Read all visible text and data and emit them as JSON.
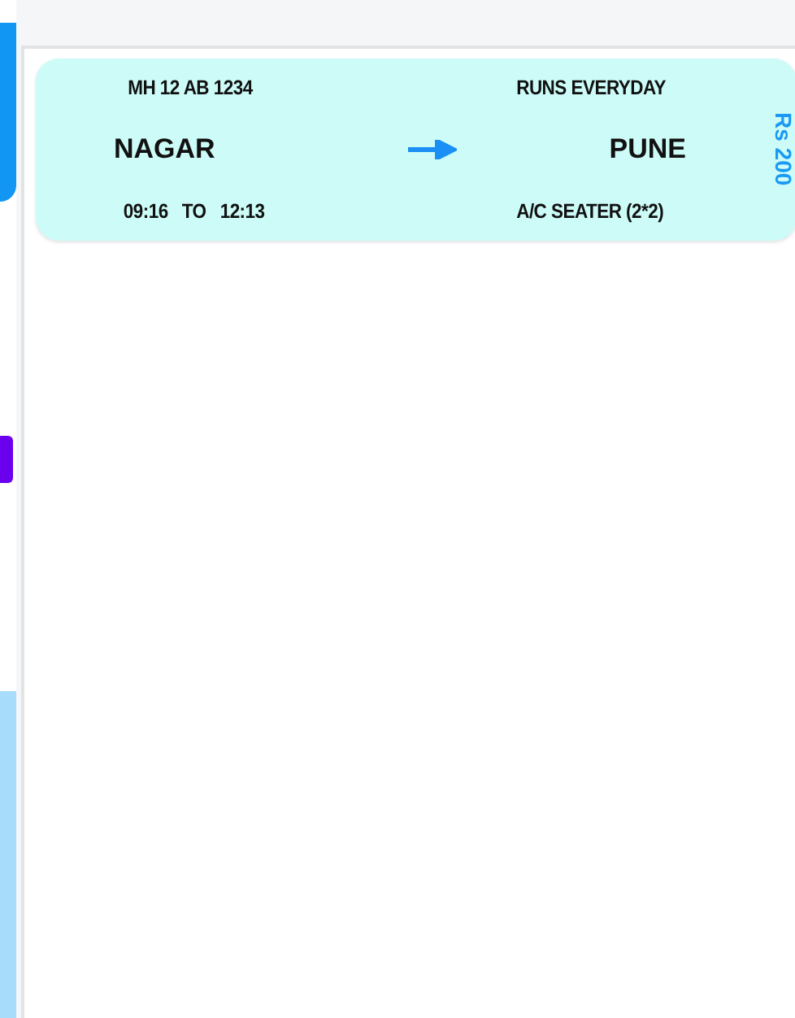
{
  "trip": {
    "bus_number": "MH 12 AB 1234",
    "schedule": "RUNS EVERYDAY",
    "from": "NAGAR",
    "to": "PUNE",
    "departure": "09:16",
    "separator": "TO",
    "arrival": "12:13",
    "bus_type": "A/C SEATER (2*2)",
    "fare": "Rs 200"
  }
}
